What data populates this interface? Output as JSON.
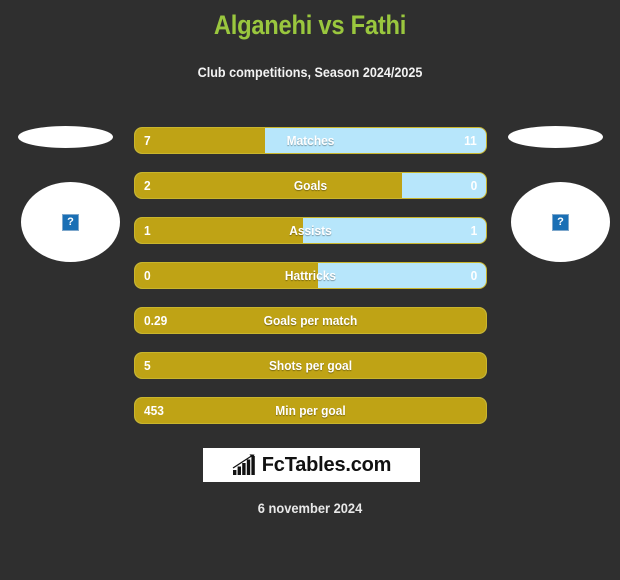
{
  "header": {
    "title": "Alganehi vs Fathi",
    "subtitle": "Club competitions, Season 2024/2025",
    "title_color": "#9ac73e"
  },
  "avatars": {
    "left": {
      "name": "home-team-avatar",
      "placeholder_glyph": "?"
    },
    "right": {
      "name": "away-team-avatar",
      "placeholder_glyph": "?"
    }
  },
  "colors": {
    "background": "#2f2f2f",
    "home_bar": "#bfa315",
    "away_bar": "#b7e6fb",
    "bar_border": "#c9b52c",
    "text": "#ffffff"
  },
  "chart_data": {
    "type": "bar",
    "title": "Alganehi vs Fathi",
    "subtitle": "Club competitions, Season 2024/2025",
    "orientation": "horizontal-diverging",
    "series": [
      {
        "name": "Alganehi",
        "color": "#bfa315"
      },
      {
        "name": "Fathi",
        "color": "#b7e6fb"
      }
    ],
    "rows": [
      {
        "label": "Matches",
        "home": "7",
        "away": "11",
        "home_pct": 37,
        "dual": true
      },
      {
        "label": "Goals",
        "home": "2",
        "away": "0",
        "home_pct": 76,
        "dual": true
      },
      {
        "label": "Assists",
        "home": "1",
        "away": "1",
        "home_pct": 48,
        "dual": true
      },
      {
        "label": "Hattricks",
        "home": "0",
        "away": "0",
        "home_pct": 52,
        "dual": true
      },
      {
        "label": "Goals per match",
        "home": "0.29",
        "away": "",
        "home_pct": 100,
        "dual": false
      },
      {
        "label": "Shots per goal",
        "home": "5",
        "away": "",
        "home_pct": 100,
        "dual": false
      },
      {
        "label": "Min per goal",
        "home": "453",
        "away": "",
        "home_pct": 100,
        "dual": false
      }
    ]
  },
  "footer": {
    "logo_text": "FcTables.com",
    "logo_icon": "bar-chart-arrow-icon",
    "date": "6 november 2024"
  }
}
